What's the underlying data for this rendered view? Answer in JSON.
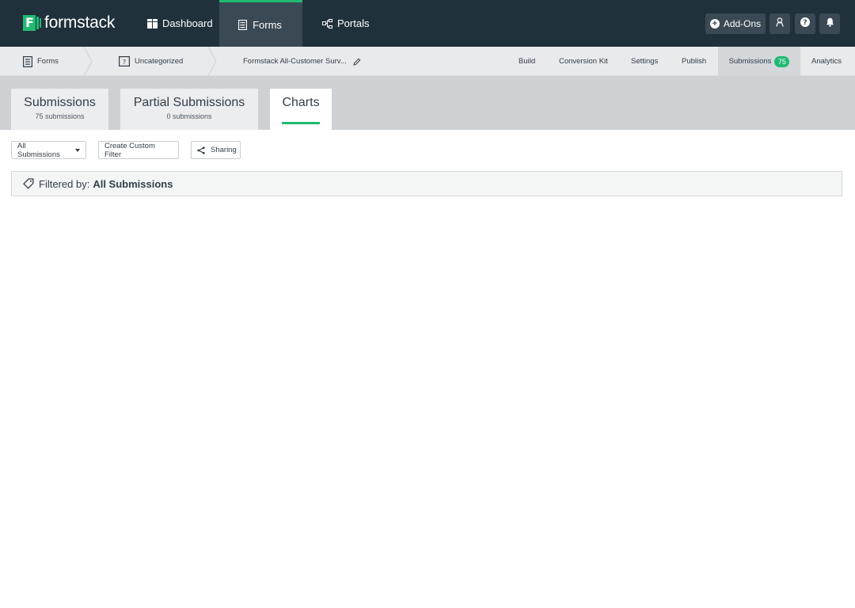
{
  "brand": {
    "name": "formstack",
    "mark_letter": "F",
    "accent": "#21ba72",
    "nav_bg": "#21313c"
  },
  "topnav": {
    "items": [
      {
        "label": "Dashboard",
        "icon": "dashboard-icon"
      },
      {
        "label": "Forms",
        "icon": "forms-icon",
        "active": true
      },
      {
        "label": "Portals",
        "icon": "portals-icon"
      }
    ],
    "addons_label": "Add-Ons",
    "icons": [
      "user-icon",
      "help-icon",
      "bell-icon"
    ]
  },
  "subnav": {
    "breadcrumb": [
      {
        "label": "Forms",
        "icon": "form-doc-icon"
      },
      {
        "label": "Uncategorized",
        "icon": "folder-icon"
      },
      {
        "label": "Formstack All-Customer Surv...",
        "icon": "edit-pencil-icon"
      }
    ],
    "tabs": [
      {
        "label": "Build"
      },
      {
        "label": "Conversion Kit"
      },
      {
        "label": "Settings"
      },
      {
        "label": "Publish"
      },
      {
        "label": "Submissions",
        "badge": "75",
        "active": true
      },
      {
        "label": "Analytics"
      }
    ]
  },
  "view_tabs": [
    {
      "title": "Submissions",
      "sub": "75 submissions"
    },
    {
      "title": "Partial Submissions",
      "sub": "0 submissions"
    },
    {
      "title": "Charts",
      "active": true
    }
  ],
  "toolbar": {
    "filter_select": "All Submissions",
    "create_filter": "Create Custom Filter",
    "sharing": "Sharing"
  },
  "filter": {
    "prefix": "Filtered by:",
    "value": "All Submissions"
  }
}
